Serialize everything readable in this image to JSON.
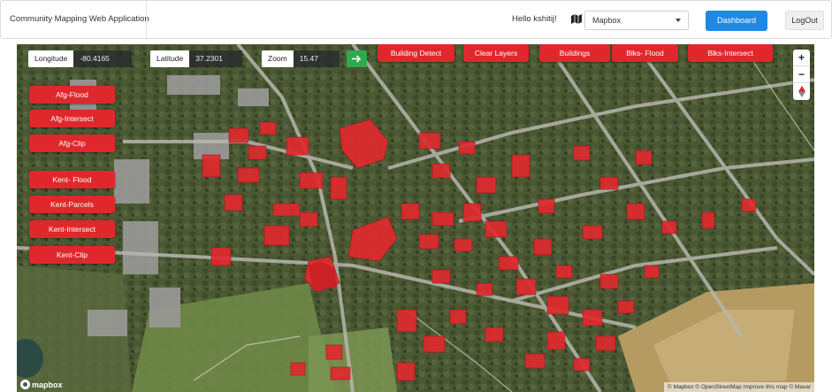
{
  "navbar": {
    "brand": "Community Mapping Web Application",
    "greeting": "Hello kshitij!",
    "map_style": {
      "selected": "Mapbox"
    },
    "dashboard_label": "Dashboard",
    "logout_label": "LogOut"
  },
  "readouts": {
    "longitude": {
      "label": "Longitude",
      "value": "-80.4165"
    },
    "latitude": {
      "label": "Latitude",
      "value": "37.2301"
    },
    "zoom": {
      "label": "Zoom",
      "value": "15.47"
    }
  },
  "toolbar": {
    "go_icon": "arrow-right-icon",
    "buttons": [
      {
        "label": "Building Detect"
      },
      {
        "label": "Clear Layers"
      },
      {
        "label": "Buildings"
      },
      {
        "label": "Blks- Flood"
      },
      {
        "label": "Blks-Intersect"
      }
    ]
  },
  "left_panel": {
    "afg": [
      {
        "label": "Afg-Flood"
      },
      {
        "label": "Afg-Intersect"
      },
      {
        "label": "Afg-Clip"
      }
    ],
    "kent": [
      {
        "label": "Kent- Flood"
      },
      {
        "label": "Kent-Parcels"
      },
      {
        "label": "Kent-Intersect"
      },
      {
        "label": "Kent-Clip"
      }
    ]
  },
  "map_controls": {
    "zoom_in": "+",
    "zoom_out": "−",
    "compass_icon": "compass-icon"
  },
  "map": {
    "logo_text": "mapbox",
    "attribution": "© Mapbox © OpenStreetMap Improve this map © Maxar",
    "highlight_color": "#e02a2e",
    "accent_color": "#1e88e5",
    "action_color": "#e0282c"
  }
}
